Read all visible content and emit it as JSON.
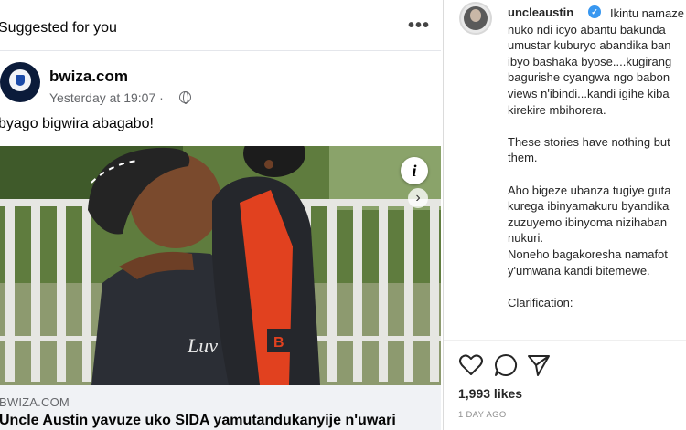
{
  "facebook": {
    "header": {
      "suggested": "Suggested for you",
      "more": "•••"
    },
    "post": {
      "page_name": "bwiza.com",
      "timestamp": "Yesterday at 19:07 ·",
      "audience_icon": "globe-icon",
      "caption": "byago bigwira abagabo!",
      "photo_actions": {
        "info_label": "i",
        "next_label": "›"
      }
    },
    "link_preview": {
      "domain": "BWIZA.COM",
      "headline": "Uncle Austin yavuze uko SIDA yamutandukanyije n'uwari"
    }
  },
  "instagram": {
    "username": "uncleaustin",
    "verified_label": "✓",
    "caption_lines": [
      "Ikintu namaze k",
      "nuko ndi icyo abantu bakunda",
      "umustar kuburyo abandika ban",
      "ibyo bashaka byose....kugirang",
      "bagurishe cyangwa ngo babon",
      "views n'ibindi...kandi igihe kiba",
      "kirekire mbihorera.",
      "",
      "These stories have nothing but",
      "them.",
      "",
      "Aho bigeze ubanza tugiye guta",
      "kurega ibinyamakuru byandika",
      "zuzuyemo ibinyoma nizihaban",
      "nukuri.",
      "Noneho bagakoresha namafot",
      "y'umwana kandi bitemewe.",
      "",
      "Clarification:"
    ],
    "actions": {
      "like_icon": "heart-icon",
      "comment_icon": "comment-icon",
      "share_icon": "share-icon"
    },
    "likes": "1,993 likes",
    "date": "1 DAY AGO"
  }
}
